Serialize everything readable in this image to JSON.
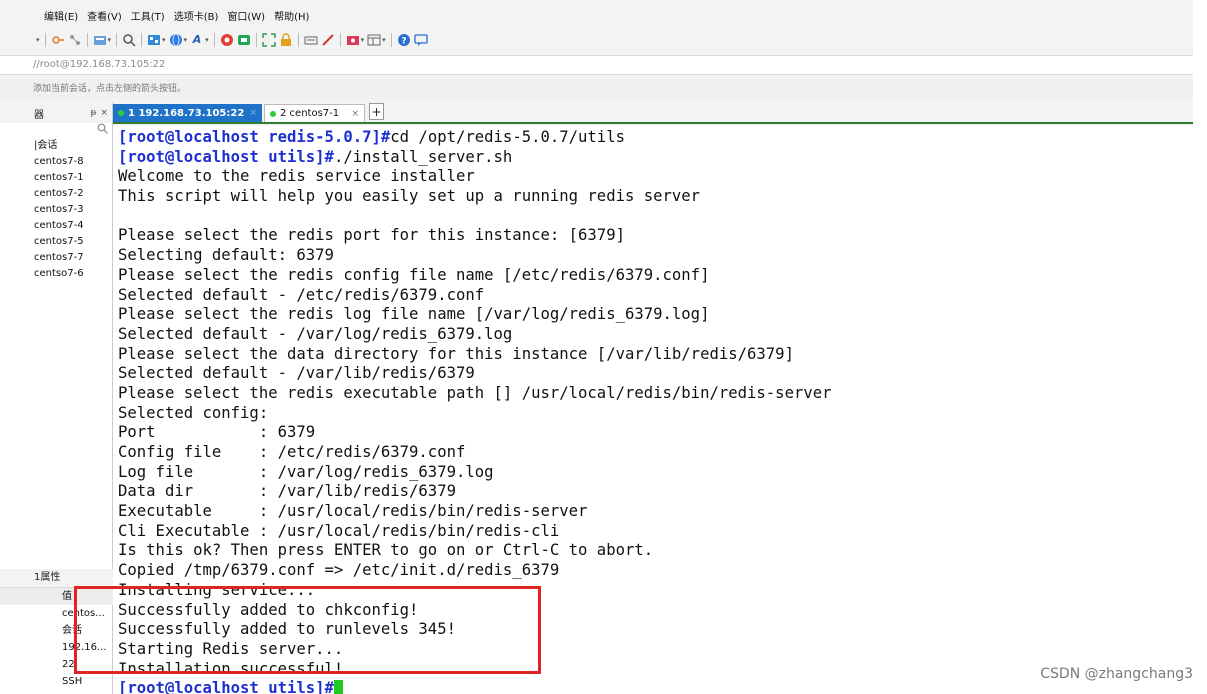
{
  "menubar": [
    "编辑(E)",
    "查看(V)",
    "工具(T)",
    "选项卡(B)",
    "窗口(W)",
    "帮助(H)"
  ],
  "toolbar": {
    "icons": [
      "toolbar-arrow-icon",
      "key-icon",
      "network-icon",
      "transfer-icon",
      "search-icon",
      "sftp-icon",
      "globe-icon",
      "font-icon",
      "color-icon",
      "xftp-icon",
      "fullscreen-icon",
      "lock-icon",
      "keyboard-icon",
      "pen-icon",
      "script-icon",
      "layout-icon",
      "help-icon",
      "chat-icon"
    ]
  },
  "address": {
    "text": "//root@192.168.73.105:22"
  },
  "hint": {
    "text": "添加当前会话，点击左侧的箭头按钮。"
  },
  "sidebar": {
    "title": "器",
    "pin": "ᵽ",
    "close": "×",
    "search_icon": "🔍",
    "root": "|会话",
    "sessions": [
      "centos7-8",
      "centos7-1",
      "centos7-2",
      "centos7-3",
      "centos7-4",
      "centos7-5",
      "centos7-7",
      "centso7-6"
    ]
  },
  "properties": {
    "title": "1属性",
    "header": "值",
    "rows": [
      "centos...",
      "会话",
      "192.16...",
      "22",
      "SSH"
    ]
  },
  "tabs": [
    {
      "label": "1 192.168.73.105:22",
      "active": true
    },
    {
      "label": "2 centos7-1",
      "active": false
    }
  ],
  "tab_add": "+",
  "terminal": {
    "lines": [
      {
        "prompt": "[root@localhost redis-5.0.7]#",
        "text": "cd /opt/redis-5.0.7/utils"
      },
      {
        "prompt": "[root@localhost utils]#",
        "text": "./install_server.sh"
      },
      {
        "prompt": "",
        "text": "Welcome to the redis service installer"
      },
      {
        "prompt": "",
        "text": "This script will help you easily set up a running redis server"
      },
      {
        "prompt": "",
        "text": ""
      },
      {
        "prompt": "",
        "text": "Please select the redis port for this instance: [6379]"
      },
      {
        "prompt": "",
        "text": "Selecting default: 6379"
      },
      {
        "prompt": "",
        "text": "Please select the redis config file name [/etc/redis/6379.conf]"
      },
      {
        "prompt": "",
        "text": "Selected default - /etc/redis/6379.conf"
      },
      {
        "prompt": "",
        "text": "Please select the redis log file name [/var/log/redis_6379.log]"
      },
      {
        "prompt": "",
        "text": "Selected default - /var/log/redis_6379.log"
      },
      {
        "prompt": "",
        "text": "Please select the data directory for this instance [/var/lib/redis/6379]"
      },
      {
        "prompt": "",
        "text": "Selected default - /var/lib/redis/6379"
      },
      {
        "prompt": "",
        "text": "Please select the redis executable path [] /usr/local/redis/bin/redis-server"
      },
      {
        "prompt": "",
        "text": "Selected config:"
      },
      {
        "prompt": "",
        "text": "Port           : 6379"
      },
      {
        "prompt": "",
        "text": "Config file    : /etc/redis/6379.conf"
      },
      {
        "prompt": "",
        "text": "Log file       : /var/log/redis_6379.log"
      },
      {
        "prompt": "",
        "text": "Data dir       : /var/lib/redis/6379"
      },
      {
        "prompt": "",
        "text": "Executable     : /usr/local/redis/bin/redis-server"
      },
      {
        "prompt": "",
        "text": "Cli Executable : /usr/local/redis/bin/redis-cli"
      },
      {
        "prompt": "",
        "text": "Is this ok? Then press ENTER to go on or Ctrl-C to abort."
      },
      {
        "prompt": "",
        "text": "Copied /tmp/6379.conf => /etc/init.d/redis_6379"
      },
      {
        "prompt": "",
        "text": "Installing service..."
      },
      {
        "prompt": "",
        "text": "Successfully added to chkconfig!"
      },
      {
        "prompt": "",
        "text": "Successfully added to runlevels 345!"
      },
      {
        "prompt": "",
        "text": "Starting Redis server..."
      },
      {
        "prompt": "",
        "text": "Installation successful!"
      },
      {
        "prompt": "[root@localhost utils]#",
        "text": ""
      }
    ]
  },
  "watermark": "CSDN @zhangchang3",
  "colors": {
    "prompt": "#1c2fd1",
    "cursor": "#22c922",
    "highlight": "#e02424",
    "active_tab": "#1e72c8"
  }
}
